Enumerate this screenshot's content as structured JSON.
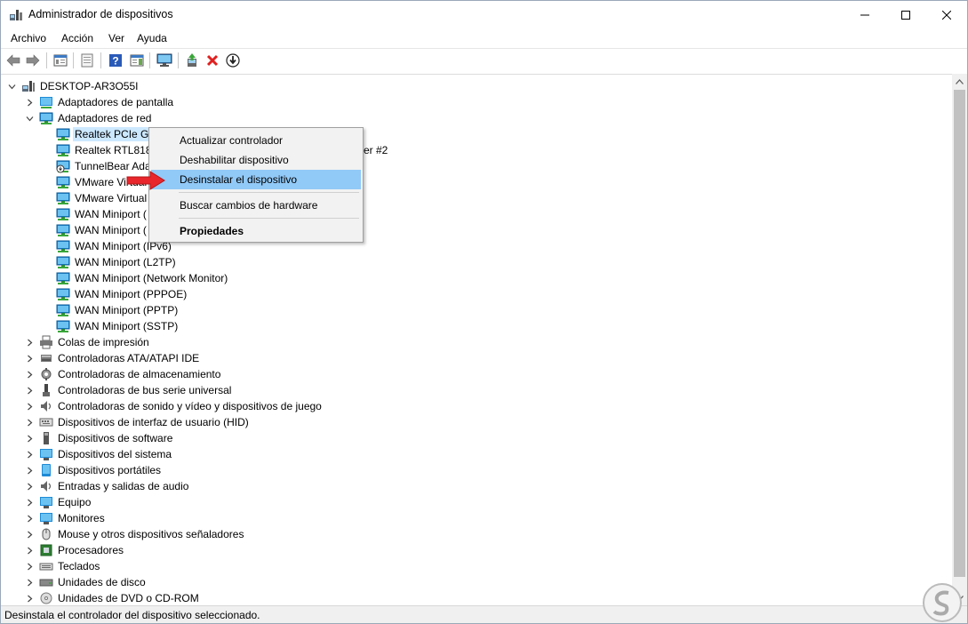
{
  "window": {
    "title": "Administrador de dispositivos"
  },
  "menubar": {
    "items": [
      "Archivo",
      "Acción",
      "Ver",
      "Ayuda"
    ]
  },
  "toolbar": {
    "buttons": [
      "back-icon",
      "forward-icon",
      "show-hide-tree-icon",
      "properties-icon",
      "help-icon",
      "action-pane-icon",
      "monitor-icon",
      "update-driver-icon",
      "uninstall-icon",
      "download-icon"
    ]
  },
  "tree": {
    "root": "DESKTOP-AR3O55I",
    "items": [
      {
        "label": "Adaptadores de pantalla",
        "level": 1,
        "expanded": false,
        "icon": "display-adapter-icon"
      },
      {
        "label": "Adaptadores de red",
        "level": 1,
        "expanded": true,
        "icon": "network-adapter-icon"
      },
      {
        "label": "Realtek PCIe GB",
        "level": 2,
        "icon": "network-adapter-icon",
        "selected": true
      },
      {
        "label": "Realtek RTL8188",
        "level": 2,
        "icon": "network-adapter-icon",
        "suffix": "pter #2"
      },
      {
        "label": "TunnelBear Ada",
        "level": 2,
        "icon": "network-adapter-warning-icon"
      },
      {
        "label": "VMware Virtual",
        "level": 2,
        "icon": "network-adapter-icon"
      },
      {
        "label": "VMware Virtual",
        "level": 2,
        "icon": "network-adapter-icon"
      },
      {
        "label": "WAN Miniport (",
        "level": 2,
        "icon": "network-adapter-icon"
      },
      {
        "label": "WAN Miniport (",
        "level": 2,
        "icon": "network-adapter-icon"
      },
      {
        "label": "WAN Miniport (IPv6)",
        "level": 2,
        "icon": "network-adapter-icon"
      },
      {
        "label": "WAN Miniport (L2TP)",
        "level": 2,
        "icon": "network-adapter-icon"
      },
      {
        "label": "WAN Miniport (Network Monitor)",
        "level": 2,
        "icon": "network-adapter-icon"
      },
      {
        "label": "WAN Miniport (PPPOE)",
        "level": 2,
        "icon": "network-adapter-icon"
      },
      {
        "label": "WAN Miniport (PPTP)",
        "level": 2,
        "icon": "network-adapter-icon"
      },
      {
        "label": "WAN Miniport (SSTP)",
        "level": 2,
        "icon": "network-adapter-icon"
      },
      {
        "label": "Colas de impresión",
        "level": 1,
        "expanded": false,
        "icon": "printer-icon"
      },
      {
        "label": "Controladoras ATA/ATAPI IDE",
        "level": 1,
        "expanded": false,
        "icon": "ide-controller-icon"
      },
      {
        "label": "Controladoras de almacenamiento",
        "level": 1,
        "expanded": false,
        "icon": "storage-controller-icon"
      },
      {
        "label": "Controladoras de bus serie universal",
        "level": 1,
        "expanded": false,
        "icon": "usb-icon"
      },
      {
        "label": "Controladoras de sonido y vídeo y dispositivos de juego",
        "level": 1,
        "expanded": false,
        "icon": "sound-icon"
      },
      {
        "label": "Dispositivos de interfaz de usuario (HID)",
        "level": 1,
        "expanded": false,
        "icon": "hid-icon"
      },
      {
        "label": "Dispositivos de software",
        "level": 1,
        "expanded": false,
        "icon": "software-device-icon"
      },
      {
        "label": "Dispositivos del sistema",
        "level": 1,
        "expanded": false,
        "icon": "system-device-icon"
      },
      {
        "label": "Dispositivos portátiles",
        "level": 1,
        "expanded": false,
        "icon": "portable-device-icon"
      },
      {
        "label": "Entradas y salidas de audio",
        "level": 1,
        "expanded": false,
        "icon": "speaker-icon"
      },
      {
        "label": "Equipo",
        "level": 1,
        "expanded": false,
        "icon": "computer-icon"
      },
      {
        "label": "Monitores",
        "level": 1,
        "expanded": false,
        "icon": "monitor-icon"
      },
      {
        "label": "Mouse y otros dispositivos señaladores",
        "level": 1,
        "expanded": false,
        "icon": "mouse-icon"
      },
      {
        "label": "Procesadores",
        "level": 1,
        "expanded": false,
        "icon": "processor-icon"
      },
      {
        "label": "Teclados",
        "level": 1,
        "expanded": false,
        "icon": "keyboard-icon"
      },
      {
        "label": "Unidades de disco",
        "level": 1,
        "expanded": false,
        "icon": "disk-drive-icon"
      },
      {
        "label": "Unidades de DVD o CD-ROM",
        "level": 1,
        "expanded": false,
        "icon": "dvd-icon"
      }
    ]
  },
  "context_menu": {
    "items": [
      {
        "label": "Actualizar controlador",
        "highlighted": false,
        "bold": false
      },
      {
        "label": "Deshabilitar dispositivo",
        "highlighted": false,
        "bold": false
      },
      {
        "label": "Desinstalar el dispositivo",
        "highlighted": true,
        "bold": false
      },
      {
        "label": "Buscar cambios de hardware",
        "highlighted": false,
        "bold": false
      },
      {
        "label": "Propiedades",
        "highlighted": false,
        "bold": true
      }
    ]
  },
  "statusbar": {
    "text": "Desinstala el controlador del dispositivo seleccionado."
  },
  "colors": {
    "highlight": "#91c9f7",
    "selection": "#cce8ff",
    "pointer_arrow": "#e8262b"
  }
}
